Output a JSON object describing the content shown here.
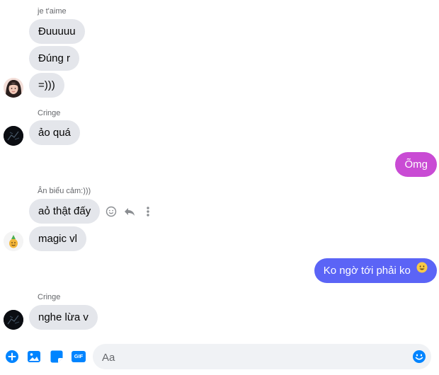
{
  "colors": {
    "bubble_received": "#e4e6eb",
    "bubble_pink": "#c94bd4",
    "bubble_blue": "#5b64f6",
    "accent": "#0084ff"
  },
  "groups": [
    {
      "sender": "je t'aime",
      "messages": [
        "Đuuuuu",
        "Đúng r",
        "=)))"
      ]
    },
    {
      "sender": "Cringe",
      "messages": [
        "ảo quá"
      ]
    },
    {
      "sender": "Ân biểu cảm:)))",
      "messages": [
        "aỏ thật đấy",
        "magic vl"
      ]
    },
    {
      "sender": "Cringe",
      "messages": [
        "nghe lừa v"
      ]
    }
  ],
  "outgoing": [
    {
      "text": "Õmg"
    },
    {
      "text": "Ko ngờ tới phải ko",
      "emoji": "smile-emoji"
    }
  ],
  "message_actions": [
    "react-icon",
    "reply-icon",
    "more-icon"
  ],
  "composer": {
    "placeholder": "Aa",
    "icons": [
      "plus-icon",
      "image-icon",
      "sticker-icon",
      "gif-icon",
      "emoji-icon"
    ],
    "gif_label": "GIF"
  }
}
